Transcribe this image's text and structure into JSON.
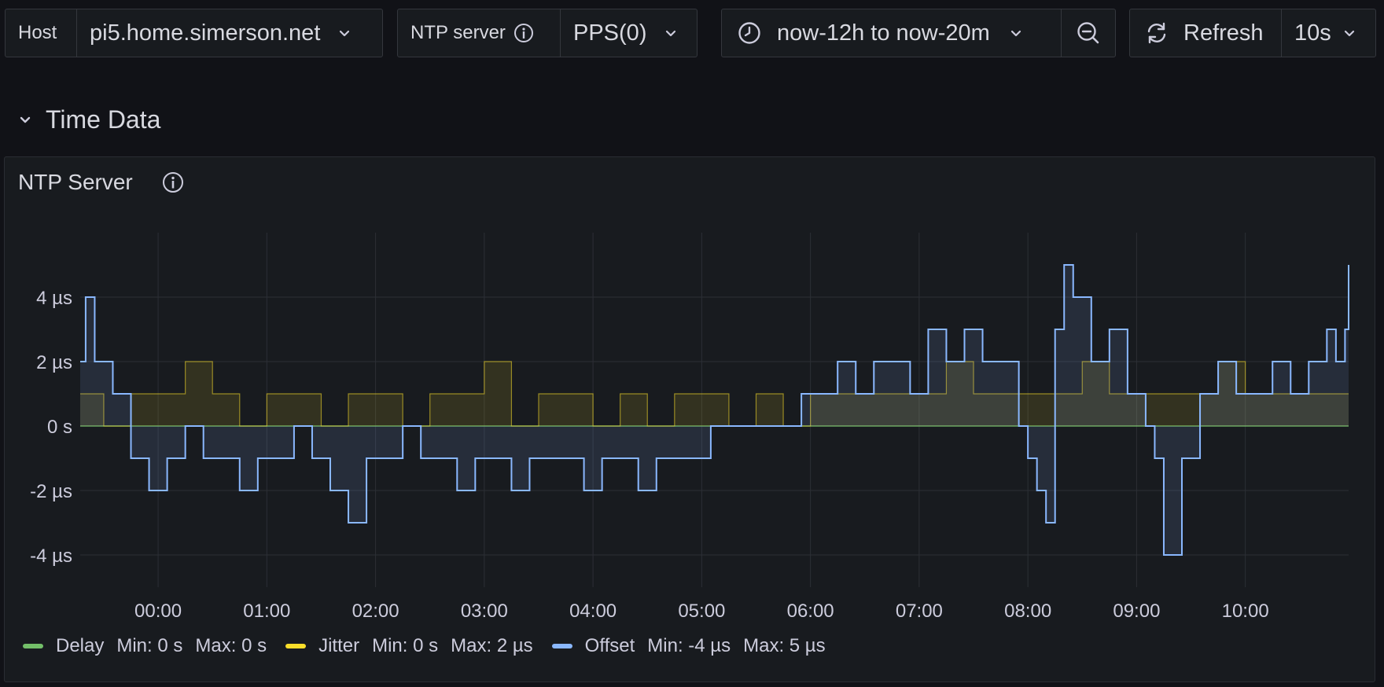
{
  "variables": {
    "host": {
      "label": "Host",
      "value": "pi5.home.simerson.net"
    },
    "ntp_server": {
      "label": "NTP server",
      "value": "PPS(0)"
    }
  },
  "time_picker": {
    "range": "now-12h to now-20m"
  },
  "refresh": {
    "label": "Refresh",
    "interval": "10s"
  },
  "section": {
    "title": "Time Data"
  },
  "panel": {
    "title": "NTP Server"
  },
  "legend": [
    {
      "name": "Delay",
      "color": "#73bf69",
      "min": "Min: 0 s",
      "max": "Max: 0 s"
    },
    {
      "name": "Jitter",
      "color": "#fade2a",
      "min": "Min: 0 s",
      "max": "Max: 2 µs"
    },
    {
      "name": "Offset",
      "color": "#8ab8ff",
      "min": "Min: -4 µs",
      "max": "Max: 5 µs"
    }
  ],
  "icons": [
    "info-icon",
    "chevron-down-icon",
    "clock-icon",
    "zoom-out-icon",
    "refresh-icon"
  ],
  "chart_data": {
    "type": "line",
    "xlim": [
      "23:17",
      "10:57"
    ],
    "ylim": [
      -5,
      6
    ],
    "y_ticks": [
      -4,
      -2,
      0,
      2,
      4
    ],
    "y_tick_labels": [
      "-4 µs",
      "-2 µs",
      "0 s",
      "2 µs",
      "4 µs"
    ],
    "x_tick_labels": [
      "00:00",
      "01:00",
      "02:00",
      "03:00",
      "04:00",
      "05:00",
      "06:00",
      "07:00",
      "08:00",
      "09:00",
      "10:00"
    ],
    "grid": true,
    "legend_position": "bottom",
    "series": [
      {
        "name": "Delay",
        "color": "#73bf69",
        "x": [
          "23:17",
          "10:57"
        ],
        "values": [
          0,
          0
        ]
      },
      {
        "name": "Jitter",
        "color": "#fade2a",
        "x": [
          "23:17",
          "23:30",
          "23:45",
          "00:00",
          "00:15",
          "00:30",
          "00:45",
          "01:00",
          "01:15",
          "01:30",
          "01:45",
          "02:00",
          "02:15",
          "02:30",
          "02:45",
          "03:00",
          "03:15",
          "03:30",
          "03:45",
          "04:00",
          "04:15",
          "04:30",
          "04:45",
          "05:00",
          "05:15",
          "05:30",
          "05:45",
          "06:00",
          "06:15",
          "06:30",
          "06:45",
          "07:00",
          "07:15",
          "07:30",
          "07:45",
          "08:00",
          "08:15",
          "08:30",
          "08:45",
          "09:00",
          "09:15",
          "09:30",
          "09:45",
          "10:00",
          "10:15",
          "10:30",
          "10:45",
          "10:57"
        ],
        "values": [
          1,
          0,
          1,
          1,
          2,
          1,
          0,
          1,
          1,
          0,
          1,
          1,
          0,
          1,
          1,
          2,
          0,
          1,
          1,
          0,
          1,
          0,
          1,
          1,
          0,
          1,
          0,
          1,
          1,
          1,
          1,
          1,
          2,
          1,
          1,
          1,
          1,
          2,
          1,
          1,
          1,
          1,
          2,
          1,
          1,
          1,
          1,
          1
        ]
      },
      {
        "name": "Offset",
        "color": "#8ab8ff",
        "x": [
          "23:17",
          "23:20",
          "23:25",
          "23:35",
          "23:45",
          "23:55",
          "00:05",
          "00:15",
          "00:25",
          "00:35",
          "00:45",
          "00:55",
          "01:05",
          "01:15",
          "01:25",
          "01:35",
          "01:45",
          "01:55",
          "02:05",
          "02:15",
          "02:25",
          "02:35",
          "02:45",
          "02:55",
          "03:05",
          "03:15",
          "03:25",
          "03:35",
          "03:45",
          "03:55",
          "04:05",
          "04:15",
          "04:25",
          "04:35",
          "04:45",
          "04:55",
          "05:05",
          "05:15",
          "05:25",
          "05:35",
          "05:45",
          "05:55",
          "06:05",
          "06:15",
          "06:25",
          "06:35",
          "06:45",
          "06:55",
          "07:05",
          "07:15",
          "07:25",
          "07:35",
          "07:45",
          "07:55",
          "08:00",
          "08:05",
          "08:10",
          "08:15",
          "08:20",
          "08:25",
          "08:35",
          "08:45",
          "08:55",
          "09:05",
          "09:10",
          "09:15",
          "09:25",
          "09:35",
          "09:45",
          "09:55",
          "10:05",
          "10:15",
          "10:25",
          "10:35",
          "10:45",
          "10:50",
          "10:55",
          "10:57"
        ],
        "values": [
          2,
          4,
          2,
          1,
          -1,
          -2,
          -1,
          0,
          -1,
          -1,
          -2,
          -1,
          -1,
          0,
          -1,
          -2,
          -3,
          -1,
          -1,
          0,
          -1,
          -1,
          -2,
          -1,
          -1,
          -2,
          -1,
          -1,
          -1,
          -2,
          -1,
          -1,
          -2,
          -1,
          -1,
          -1,
          0,
          0,
          0,
          0,
          0,
          1,
          1,
          2,
          1,
          2,
          2,
          1,
          3,
          2,
          3,
          2,
          2,
          0,
          -1,
          -2,
          -3,
          3,
          5,
          4,
          2,
          3,
          1,
          0,
          -1,
          -4,
          -1,
          1,
          2,
          1,
          1,
          2,
          1,
          2,
          3,
          2,
          3,
          5
        ]
      }
    ]
  }
}
